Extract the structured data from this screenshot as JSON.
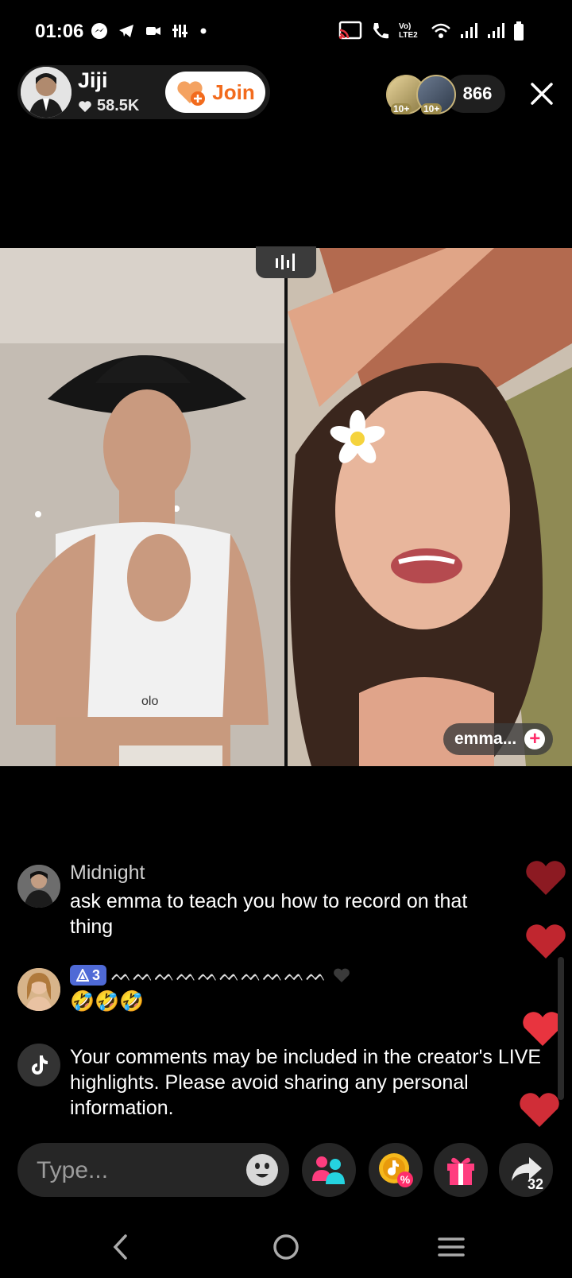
{
  "status_bar": {
    "time": "01:06",
    "network_label": "Vo) LTE2"
  },
  "host": {
    "name": "Jiji",
    "likes": "58.5K",
    "join_label": "Join"
  },
  "viewers": {
    "avatar_levels": [
      "10+",
      "10+"
    ],
    "count": "866"
  },
  "guest": {
    "name": "emma...",
    "add_symbol": "+"
  },
  "comments": [
    {
      "user": "Midnight",
      "text": "ask emma to teach you how to record on that thing"
    },
    {
      "badge_level": "3",
      "user": "ᨓᨓᨓᨓᨓᨓᨓᨓᨓᨓ",
      "text": "🤣🤣🤣"
    },
    {
      "text": "Your comments may be included in the creator's LIVE highlights. Please avoid sharing any personal information."
    }
  ],
  "input": {
    "placeholder": "Type..."
  },
  "actions": {
    "share_count": "32"
  },
  "colors": {
    "join_orange": "#f26b1d",
    "heart_red": "#e8343f",
    "badge_blue": "#4f6ad6"
  }
}
